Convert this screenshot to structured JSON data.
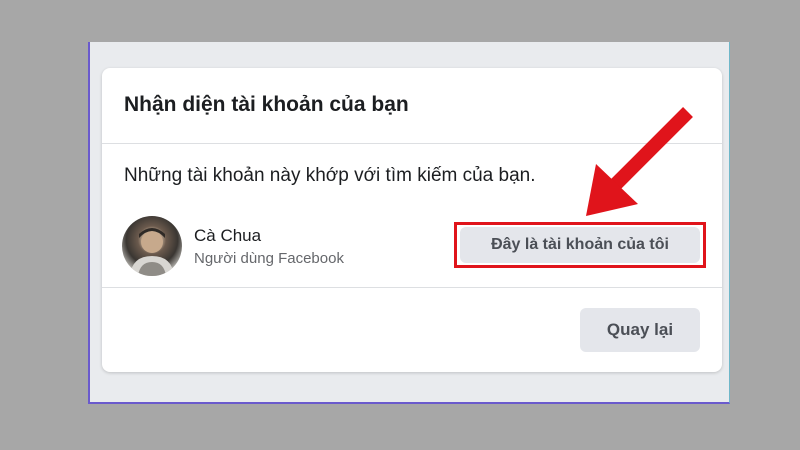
{
  "dialog": {
    "title": "Nhận diện tài khoản của bạn",
    "description": "Những tài khoản này khớp với tìm kiếm của bạn."
  },
  "account": {
    "name": "Cà Chua",
    "subtitle": "Người dùng Facebook",
    "confirm_label": "Đây là tài khoản của tôi"
  },
  "footer": {
    "back_label": "Quay lại"
  },
  "colors": {
    "highlight": "#e0141b",
    "arrow": "#e0141b",
    "button_bg": "#e4e6eb"
  },
  "icons": {
    "annotation": "red-arrow-icon"
  }
}
